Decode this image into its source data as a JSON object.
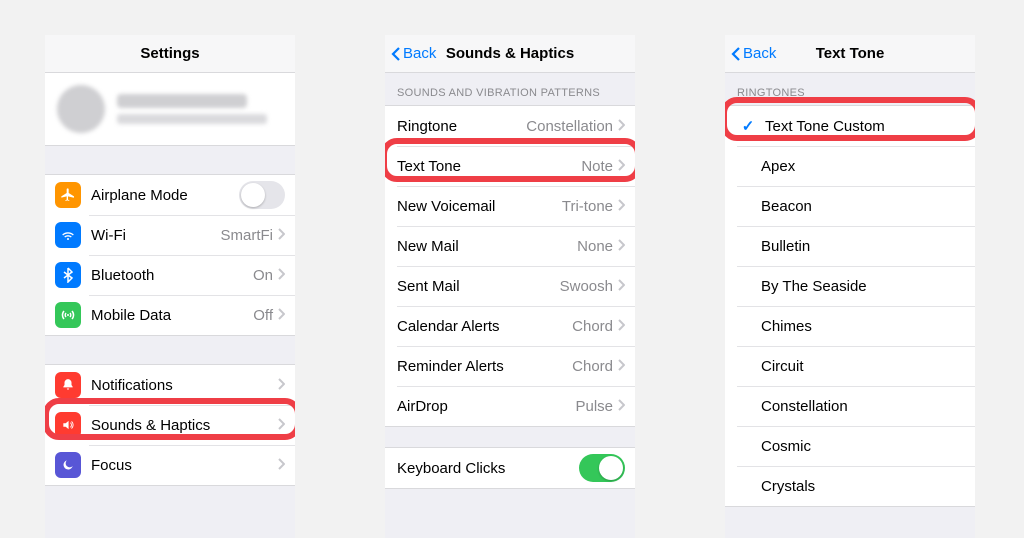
{
  "screen1": {
    "title": "Settings",
    "rows": {
      "airplane": {
        "label": "Airplane Mode"
      },
      "wifi": {
        "label": "Wi-Fi",
        "value": "SmartFi"
      },
      "bluetooth": {
        "label": "Bluetooth",
        "value": "On"
      },
      "mobile": {
        "label": "Mobile Data",
        "value": "Off"
      },
      "notifications": {
        "label": "Notifications"
      },
      "sounds": {
        "label": "Sounds & Haptics"
      },
      "focus": {
        "label": "Focus"
      }
    },
    "icons": {
      "airplane": "#ff9500",
      "wifi": "#007aff",
      "bluetooth": "#007aff",
      "mobile": "#34c759",
      "notifications": "#ff3b30",
      "sounds": "#ff3b30",
      "focus": "#5856d6"
    }
  },
  "screen2": {
    "back": "Back",
    "title": "Sounds & Haptics",
    "section": "SOUNDS AND VIBRATION PATTERNS",
    "rows": [
      {
        "label": "Ringtone",
        "value": "Constellation"
      },
      {
        "label": "Text Tone",
        "value": "Note"
      },
      {
        "label": "New Voicemail",
        "value": "Tri-tone"
      },
      {
        "label": "New Mail",
        "value": "None"
      },
      {
        "label": "Sent Mail",
        "value": "Swoosh"
      },
      {
        "label": "Calendar Alerts",
        "value": "Chord"
      },
      {
        "label": "Reminder Alerts",
        "value": "Chord"
      },
      {
        "label": "AirDrop",
        "value": "Pulse"
      }
    ],
    "keyboard": {
      "label": "Keyboard Clicks"
    }
  },
  "screen3": {
    "back": "Back",
    "title": "Text Tone",
    "section": "RINGTONES",
    "selected": "Text Tone Custom",
    "items": [
      "Apex",
      "Beacon",
      "Bulletin",
      "By The Seaside",
      "Chimes",
      "Circuit",
      "Constellation",
      "Cosmic",
      "Crystals"
    ]
  }
}
